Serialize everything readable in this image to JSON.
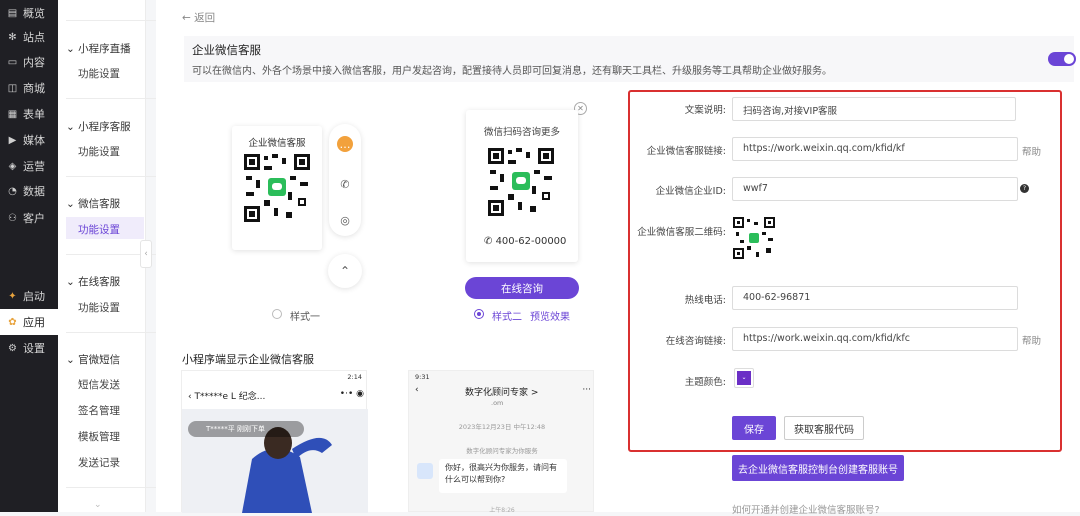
{
  "nav": {
    "items": [
      {
        "label": "概览",
        "icon": "chart-icon"
      },
      {
        "label": "站点",
        "icon": "gear-icon"
      },
      {
        "label": "内容",
        "icon": "document-icon"
      },
      {
        "label": "商城",
        "icon": "shop-icon"
      },
      {
        "label": "表单",
        "icon": "form-icon"
      },
      {
        "label": "媒体",
        "icon": "media-icon"
      },
      {
        "label": "运营",
        "icon": "tag-icon"
      },
      {
        "label": "数据",
        "icon": "pie-icon"
      },
      {
        "label": "客户",
        "icon": "user-icon"
      },
      {
        "label": "启动",
        "icon": "launch-icon"
      },
      {
        "label": "应用",
        "icon": "app-icon"
      },
      {
        "label": "设置",
        "icon": "settings-icon"
      }
    ]
  },
  "submenu": {
    "groups": [
      {
        "title": "小程序直播",
        "link": "功能设置"
      },
      {
        "title": "小程序客服",
        "link": "功能设置"
      },
      {
        "title": "微信客服",
        "link": "功能设置"
      },
      {
        "title": "在线客服",
        "link": "功能设置"
      },
      {
        "title": "官微短信",
        "links": [
          "短信发送",
          "签名管理",
          "模板管理",
          "发送记录"
        ]
      }
    ]
  },
  "main": {
    "back": "返回",
    "service_title": "企业微信客服",
    "service_desc": "可以在微信内、外各个场景中接入微信客服，用户发起咨询，配置接待人员即可回复消息，还有聊天工具栏、升级服务等工具帮助企业做好服务。",
    "style1": {
      "card_title": "企业微信客服",
      "label": "样式一"
    },
    "style2": {
      "card_title": "微信扫码咨询更多",
      "phone": "400-62-00000",
      "consult_button": "在线咨询",
      "label": "样式二",
      "preview": "预览效果"
    },
    "section_title": "小程序端显示企业微信客服",
    "mock1": {
      "time": "2:14",
      "title": "T*****e L 纪念...",
      "bubble": "T*****平 刚刚下单"
    },
    "mock2": {
      "time": "9:31",
      "title": "数字化顾问专家 >",
      "subtitle": ".om",
      "timestamp": "2023年12月23日 中午12:48",
      "notice": "数字化顾问专家为你服务",
      "message": "你好，很高兴为你服务，请问有什么可以帮到你?",
      "time2": "上午8:26"
    }
  },
  "form": {
    "copy_label": "文案说明:",
    "copy_value": "扫码咨询,对接VIP客服",
    "link_label": "企业微信客服链接:",
    "link_value": "https://work.weixin.qq.com/kfid/kf",
    "link_help": "帮助",
    "corpid_label": "企业微信企业ID:",
    "corpid_value": "wwf7",
    "qr_label": "企业微信客服二维码:",
    "hotline_label": "热线电话:",
    "hotline_value": "400-62-96871",
    "online_label": "在线咨询链接:",
    "online_value": "https://work.weixin.qq.com/kfid/kfc",
    "online_help": "帮助",
    "theme_label": "主题颜色:",
    "theme_color": "#6b2fc6",
    "save": "保存",
    "get_code": "获取客服代码",
    "create_account": "去企业微信客服控制台创建客服账号",
    "howto": "如何开通并创建企业微信客服账号?"
  }
}
